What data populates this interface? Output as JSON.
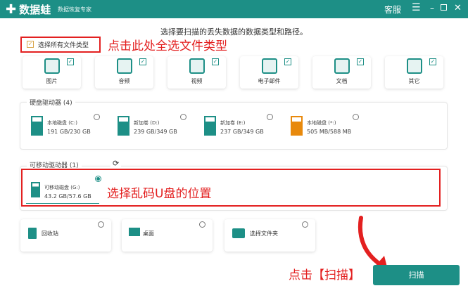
{
  "header": {
    "app_name": "数据蛙",
    "tagline": "数据恢复专家",
    "support": "客服",
    "menu_icon": "menu-icon",
    "min_icon": "minimize-icon",
    "max_icon": "maximize-icon",
    "close_icon": "close-icon"
  },
  "subtitle": "选择要扫描的丢失数据的数据类型和路径。",
  "select_all": {
    "label": "选择所有文件类型",
    "checked": true
  },
  "annotations": {
    "select_all": "点击此处全选文件类型",
    "usb": "选择乱码U盘的位置",
    "scan": "点击【扫描】"
  },
  "file_types": [
    {
      "label": "图片",
      "icon": "image-icon",
      "checked": true
    },
    {
      "label": "音频",
      "icon": "audio-icon",
      "checked": true
    },
    {
      "label": "视频",
      "icon": "video-icon",
      "checked": true
    },
    {
      "label": "电子邮件",
      "icon": "email-icon",
      "checked": true
    },
    {
      "label": "文档",
      "icon": "document-icon",
      "checked": true
    },
    {
      "label": "其它",
      "icon": "other-icon",
      "checked": true
    }
  ],
  "hard_drives": {
    "label": "硬盘驱动器 (4)",
    "items": [
      {
        "name": "本地磁盘 (C:)",
        "size": "191 GB/230 GB",
        "color": "#1d8f86"
      },
      {
        "name": "新加卷 (D:)",
        "size": "239 GB/349 GB",
        "color": "#1d8f86"
      },
      {
        "name": "新加卷 (E:)",
        "size": "237 GB/349 GB",
        "color": "#1d8f86"
      },
      {
        "name": "本地磁盘 (*:)",
        "size": "505 MB/588 MB",
        "color": "#e8890c"
      }
    ]
  },
  "removable": {
    "label": "可移动驱动器 (1)",
    "items": [
      {
        "name": "可移动磁盘 (G:)",
        "size": "43.2 GB/57.6 GB",
        "selected": true
      }
    ]
  },
  "locations": [
    {
      "label": "回收站",
      "icon": "recycle-bin-icon"
    },
    {
      "label": "桌面",
      "icon": "desktop-icon"
    },
    {
      "label": "选择文件夹",
      "icon": "folder-icon"
    }
  ],
  "scan_button": "扫描",
  "colors": {
    "accent": "#1d8f86",
    "annotation": "#e32020",
    "warning": "#e8890c"
  }
}
